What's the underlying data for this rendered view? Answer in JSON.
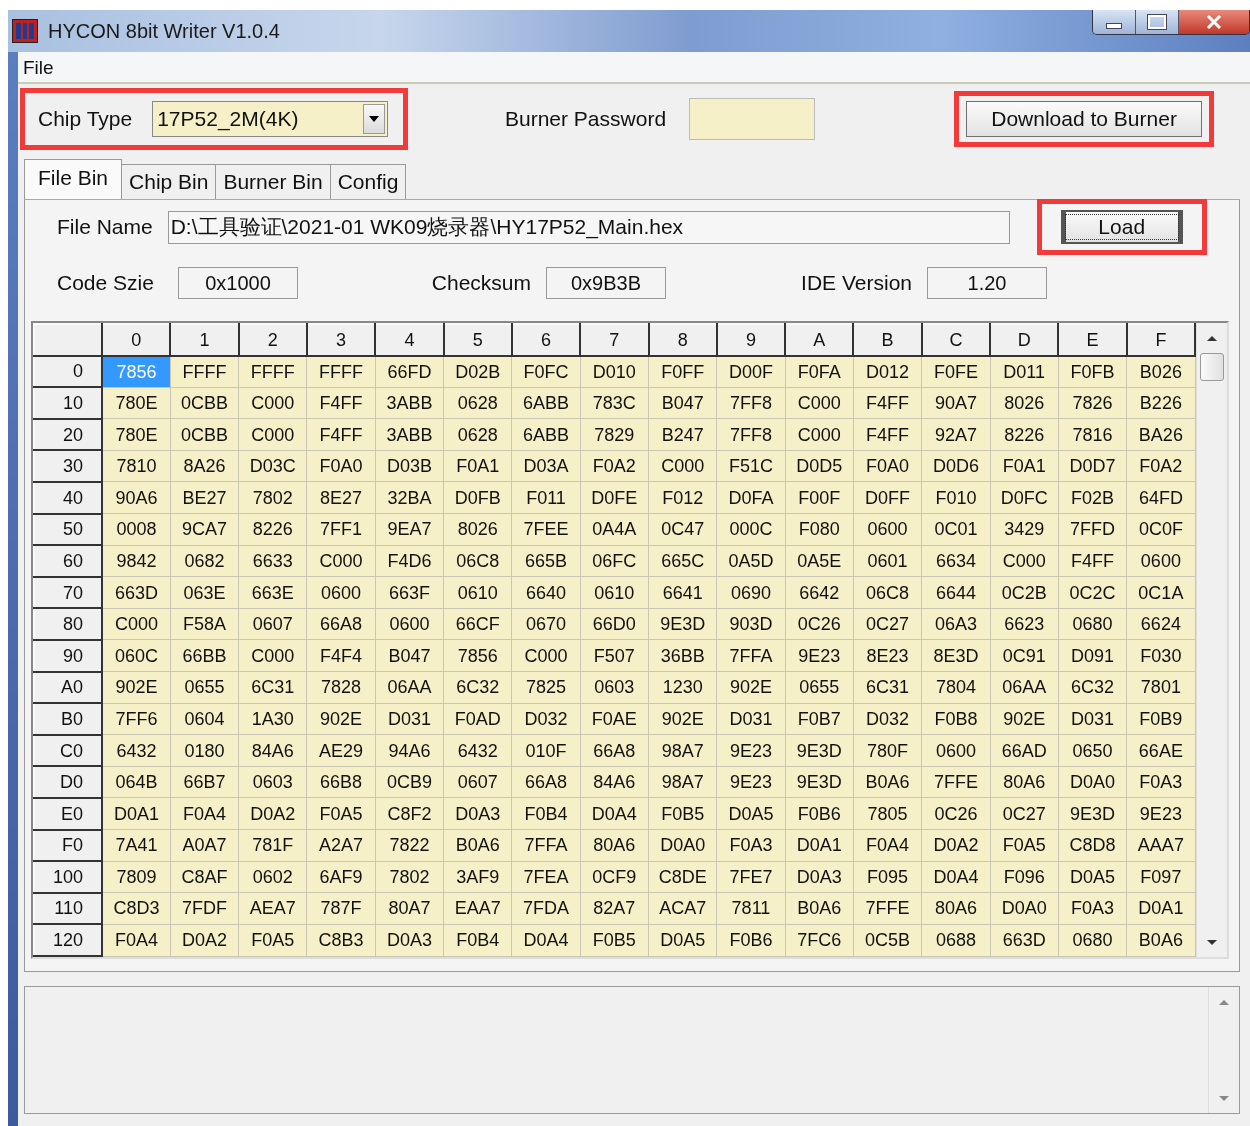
{
  "window": {
    "title": "HYCON 8bit Writer V1.0.4"
  },
  "menu": [
    {
      "label": "File"
    }
  ],
  "chip_type": {
    "label": "Chip Type",
    "value": "17P52_2M(4K)",
    "highlighted": true
  },
  "burner_password": {
    "label": "Burner Password"
  },
  "download_button": {
    "label": "Download to Burner",
    "highlighted": true
  },
  "tabs": [
    {
      "label": "File Bin",
      "selected": true
    },
    {
      "label": "Chip Bin",
      "selected": false
    },
    {
      "label": "Burner Bin",
      "selected": false
    },
    {
      "label": "Config",
      "selected": false
    }
  ],
  "file_name": {
    "label": "File Name",
    "value": "D:\\工具验证\\2021-01 WK09烧录器\\HY17P52_Main.hex"
  },
  "load_button": {
    "label": "Load",
    "highlighted": true
  },
  "info": [
    {
      "label": "Code Szie",
      "value": "0x1000"
    },
    {
      "label": "Checksum",
      "value": "0x9B3B"
    },
    {
      "label": "IDE Version",
      "value": "1.20"
    }
  ],
  "table": {
    "columns": [
      "0",
      "1",
      "2",
      "3",
      "4",
      "5",
      "6",
      "7",
      "8",
      "9",
      "A",
      "B",
      "C",
      "D",
      "E",
      "F"
    ],
    "rows": [
      {
        "address": "0",
        "cells": [
          {
            "text": "7856",
            "selected": true
          },
          {
            "text": "FFFF",
            "selected": false
          },
          {
            "text": "FFFF",
            "selected": false
          },
          {
            "text": "FFFF",
            "selected": false
          },
          {
            "text": "66FD",
            "selected": false
          },
          {
            "text": "D02B",
            "selected": false
          },
          {
            "text": "F0FC",
            "selected": false
          },
          {
            "text": "D010",
            "selected": false
          },
          {
            "text": "F0FF",
            "selected": false
          },
          {
            "text": "D00F",
            "selected": false
          },
          {
            "text": "F0FA",
            "selected": false
          },
          {
            "text": "D012",
            "selected": false
          },
          {
            "text": "F0FE",
            "selected": false
          },
          {
            "text": "D011",
            "selected": false
          },
          {
            "text": "F0FB",
            "selected": false
          },
          {
            "text": "B026",
            "selected": false
          }
        ]
      },
      {
        "address": "10",
        "cells": [
          {
            "text": "780E",
            "selected": false
          },
          {
            "text": "0CBB",
            "selected": false
          },
          {
            "text": "C000",
            "selected": false
          },
          {
            "text": "F4FF",
            "selected": false
          },
          {
            "text": "3ABB",
            "selected": false
          },
          {
            "text": "0628",
            "selected": false
          },
          {
            "text": "6ABB",
            "selected": false
          },
          {
            "text": "783C",
            "selected": false
          },
          {
            "text": "B047",
            "selected": false
          },
          {
            "text": "7FF8",
            "selected": false
          },
          {
            "text": "C000",
            "selected": false
          },
          {
            "text": "F4FF",
            "selected": false
          },
          {
            "text": "90A7",
            "selected": false
          },
          {
            "text": "8026",
            "selected": false
          },
          {
            "text": "7826",
            "selected": false
          },
          {
            "text": "B226",
            "selected": false
          }
        ]
      },
      {
        "address": "20",
        "cells": [
          {
            "text": "780E",
            "selected": false
          },
          {
            "text": "0CBB",
            "selected": false
          },
          {
            "text": "C000",
            "selected": false
          },
          {
            "text": "F4FF",
            "selected": false
          },
          {
            "text": "3ABB",
            "selected": false
          },
          {
            "text": "0628",
            "selected": false
          },
          {
            "text": "6ABB",
            "selected": false
          },
          {
            "text": "7829",
            "selected": false
          },
          {
            "text": "B247",
            "selected": false
          },
          {
            "text": "7FF8",
            "selected": false
          },
          {
            "text": "C000",
            "selected": false
          },
          {
            "text": "F4FF",
            "selected": false
          },
          {
            "text": "92A7",
            "selected": false
          },
          {
            "text": "8226",
            "selected": false
          },
          {
            "text": "7816",
            "selected": false
          },
          {
            "text": "BA26",
            "selected": false
          }
        ]
      },
      {
        "address": "30",
        "cells": [
          {
            "text": "7810",
            "selected": false
          },
          {
            "text": "8A26",
            "selected": false
          },
          {
            "text": "D03C",
            "selected": false
          },
          {
            "text": "F0A0",
            "selected": false
          },
          {
            "text": "D03B",
            "selected": false
          },
          {
            "text": "F0A1",
            "selected": false
          },
          {
            "text": "D03A",
            "selected": false
          },
          {
            "text": "F0A2",
            "selected": false
          },
          {
            "text": "C000",
            "selected": false
          },
          {
            "text": "F51C",
            "selected": false
          },
          {
            "text": "D0D5",
            "selected": false
          },
          {
            "text": "F0A0",
            "selected": false
          },
          {
            "text": "D0D6",
            "selected": false
          },
          {
            "text": "F0A1",
            "selected": false
          },
          {
            "text": "D0D7",
            "selected": false
          },
          {
            "text": "F0A2",
            "selected": false
          }
        ]
      },
      {
        "address": "40",
        "cells": [
          {
            "text": "90A6",
            "selected": false
          },
          {
            "text": "BE27",
            "selected": false
          },
          {
            "text": "7802",
            "selected": false
          },
          {
            "text": "8E27",
            "selected": false
          },
          {
            "text": "32BA",
            "selected": false
          },
          {
            "text": "D0FB",
            "selected": false
          },
          {
            "text": "F011",
            "selected": false
          },
          {
            "text": "D0FE",
            "selected": false
          },
          {
            "text": "F012",
            "selected": false
          },
          {
            "text": "D0FA",
            "selected": false
          },
          {
            "text": "F00F",
            "selected": false
          },
          {
            "text": "D0FF",
            "selected": false
          },
          {
            "text": "F010",
            "selected": false
          },
          {
            "text": "D0FC",
            "selected": false
          },
          {
            "text": "F02B",
            "selected": false
          },
          {
            "text": "64FD",
            "selected": false
          }
        ]
      },
      {
        "address": "50",
        "cells": [
          {
            "text": "0008",
            "selected": false
          },
          {
            "text": "9CA7",
            "selected": false
          },
          {
            "text": "8226",
            "selected": false
          },
          {
            "text": "7FF1",
            "selected": false
          },
          {
            "text": "9EA7",
            "selected": false
          },
          {
            "text": "8026",
            "selected": false
          },
          {
            "text": "7FEE",
            "selected": false
          },
          {
            "text": "0A4A",
            "selected": false
          },
          {
            "text": "0C47",
            "selected": false
          },
          {
            "text": "000C",
            "selected": false
          },
          {
            "text": "F080",
            "selected": false
          },
          {
            "text": "0600",
            "selected": false
          },
          {
            "text": "0C01",
            "selected": false
          },
          {
            "text": "3429",
            "selected": false
          },
          {
            "text": "7FFD",
            "selected": false
          },
          {
            "text": "0C0F",
            "selected": false
          }
        ]
      },
      {
        "address": "60",
        "cells": [
          {
            "text": "9842",
            "selected": false
          },
          {
            "text": "0682",
            "selected": false
          },
          {
            "text": "6633",
            "selected": false
          },
          {
            "text": "C000",
            "selected": false
          },
          {
            "text": "F4D6",
            "selected": false
          },
          {
            "text": "06C8",
            "selected": false
          },
          {
            "text": "665B",
            "selected": false
          },
          {
            "text": "06FC",
            "selected": false
          },
          {
            "text": "665C",
            "selected": false
          },
          {
            "text": "0A5D",
            "selected": false
          },
          {
            "text": "0A5E",
            "selected": false
          },
          {
            "text": "0601",
            "selected": false
          },
          {
            "text": "6634",
            "selected": false
          },
          {
            "text": "C000",
            "selected": false
          },
          {
            "text": "F4FF",
            "selected": false
          },
          {
            "text": "0600",
            "selected": false
          }
        ]
      },
      {
        "address": "70",
        "cells": [
          {
            "text": "663D",
            "selected": false
          },
          {
            "text": "063E",
            "selected": false
          },
          {
            "text": "663E",
            "selected": false
          },
          {
            "text": "0600",
            "selected": false
          },
          {
            "text": "663F",
            "selected": false
          },
          {
            "text": "0610",
            "selected": false
          },
          {
            "text": "6640",
            "selected": false
          },
          {
            "text": "0610",
            "selected": false
          },
          {
            "text": "6641",
            "selected": false
          },
          {
            "text": "0690",
            "selected": false
          },
          {
            "text": "6642",
            "selected": false
          },
          {
            "text": "06C8",
            "selected": false
          },
          {
            "text": "6644",
            "selected": false
          },
          {
            "text": "0C2B",
            "selected": false
          },
          {
            "text": "0C2C",
            "selected": false
          },
          {
            "text": "0C1A",
            "selected": false
          }
        ]
      },
      {
        "address": "80",
        "cells": [
          {
            "text": "C000",
            "selected": false
          },
          {
            "text": "F58A",
            "selected": false
          },
          {
            "text": "0607",
            "selected": false
          },
          {
            "text": "66A8",
            "selected": false
          },
          {
            "text": "0600",
            "selected": false
          },
          {
            "text": "66CF",
            "selected": false
          },
          {
            "text": "0670",
            "selected": false
          },
          {
            "text": "66D0",
            "selected": false
          },
          {
            "text": "9E3D",
            "selected": false
          },
          {
            "text": "903D",
            "selected": false
          },
          {
            "text": "0C26",
            "selected": false
          },
          {
            "text": "0C27",
            "selected": false
          },
          {
            "text": "06A3",
            "selected": false
          },
          {
            "text": "6623",
            "selected": false
          },
          {
            "text": "0680",
            "selected": false
          },
          {
            "text": "6624",
            "selected": false
          }
        ]
      },
      {
        "address": "90",
        "cells": [
          {
            "text": "060C",
            "selected": false
          },
          {
            "text": "66BB",
            "selected": false
          },
          {
            "text": "C000",
            "selected": false
          },
          {
            "text": "F4F4",
            "selected": false
          },
          {
            "text": "B047",
            "selected": false
          },
          {
            "text": "7856",
            "selected": false
          },
          {
            "text": "C000",
            "selected": false
          },
          {
            "text": "F507",
            "selected": false
          },
          {
            "text": "36BB",
            "selected": false
          },
          {
            "text": "7FFA",
            "selected": false
          },
          {
            "text": "9E23",
            "selected": false
          },
          {
            "text": "8E23",
            "selected": false
          },
          {
            "text": "8E3D",
            "selected": false
          },
          {
            "text": "0C91",
            "selected": false
          },
          {
            "text": "D091",
            "selected": false
          },
          {
            "text": "F030",
            "selected": false
          }
        ]
      },
      {
        "address": "A0",
        "cells": [
          {
            "text": "902E",
            "selected": false
          },
          {
            "text": "0655",
            "selected": false
          },
          {
            "text": "6C31",
            "selected": false
          },
          {
            "text": "7828",
            "selected": false
          },
          {
            "text": "06AA",
            "selected": false
          },
          {
            "text": "6C32",
            "selected": false
          },
          {
            "text": "7825",
            "selected": false
          },
          {
            "text": "0603",
            "selected": false
          },
          {
            "text": "1230",
            "selected": false
          },
          {
            "text": "902E",
            "selected": false
          },
          {
            "text": "0655",
            "selected": false
          },
          {
            "text": "6C31",
            "selected": false
          },
          {
            "text": "7804",
            "selected": false
          },
          {
            "text": "06AA",
            "selected": false
          },
          {
            "text": "6C32",
            "selected": false
          },
          {
            "text": "7801",
            "selected": false
          }
        ]
      },
      {
        "address": "B0",
        "cells": [
          {
            "text": "7FF6",
            "selected": false
          },
          {
            "text": "0604",
            "selected": false
          },
          {
            "text": "1A30",
            "selected": false
          },
          {
            "text": "902E",
            "selected": false
          },
          {
            "text": "D031",
            "selected": false
          },
          {
            "text": "F0AD",
            "selected": false
          },
          {
            "text": "D032",
            "selected": false
          },
          {
            "text": "F0AE",
            "selected": false
          },
          {
            "text": "902E",
            "selected": false
          },
          {
            "text": "D031",
            "selected": false
          },
          {
            "text": "F0B7",
            "selected": false
          },
          {
            "text": "D032",
            "selected": false
          },
          {
            "text": "F0B8",
            "selected": false
          },
          {
            "text": "902E",
            "selected": false
          },
          {
            "text": "D031",
            "selected": false
          },
          {
            "text": "F0B9",
            "selected": false
          }
        ]
      },
      {
        "address": "C0",
        "cells": [
          {
            "text": "6432",
            "selected": false
          },
          {
            "text": "0180",
            "selected": false
          },
          {
            "text": "84A6",
            "selected": false
          },
          {
            "text": "AE29",
            "selected": false
          },
          {
            "text": "94A6",
            "selected": false
          },
          {
            "text": "6432",
            "selected": false
          },
          {
            "text": "010F",
            "selected": false
          },
          {
            "text": "66A8",
            "selected": false
          },
          {
            "text": "98A7",
            "selected": false
          },
          {
            "text": "9E23",
            "selected": false
          },
          {
            "text": "9E3D",
            "selected": false
          },
          {
            "text": "780F",
            "selected": false
          },
          {
            "text": "0600",
            "selected": false
          },
          {
            "text": "66AD",
            "selected": false
          },
          {
            "text": "0650",
            "selected": false
          },
          {
            "text": "66AE",
            "selected": false
          }
        ]
      },
      {
        "address": "D0",
        "cells": [
          {
            "text": "064B",
            "selected": false
          },
          {
            "text": "66B7",
            "selected": false
          },
          {
            "text": "0603",
            "selected": false
          },
          {
            "text": "66B8",
            "selected": false
          },
          {
            "text": "0CB9",
            "selected": false
          },
          {
            "text": "0607",
            "selected": false
          },
          {
            "text": "66A8",
            "selected": false
          },
          {
            "text": "84A6",
            "selected": false
          },
          {
            "text": "98A7",
            "selected": false
          },
          {
            "text": "9E23",
            "selected": false
          },
          {
            "text": "9E3D",
            "selected": false
          },
          {
            "text": "B0A6",
            "selected": false
          },
          {
            "text": "7FFE",
            "selected": false
          },
          {
            "text": "80A6",
            "selected": false
          },
          {
            "text": "D0A0",
            "selected": false
          },
          {
            "text": "F0A3",
            "selected": false
          }
        ]
      },
      {
        "address": "E0",
        "cells": [
          {
            "text": "D0A1",
            "selected": false
          },
          {
            "text": "F0A4",
            "selected": false
          },
          {
            "text": "D0A2",
            "selected": false
          },
          {
            "text": "F0A5",
            "selected": false
          },
          {
            "text": "C8F2",
            "selected": false
          },
          {
            "text": "D0A3",
            "selected": false
          },
          {
            "text": "F0B4",
            "selected": false
          },
          {
            "text": "D0A4",
            "selected": false
          },
          {
            "text": "F0B5",
            "selected": false
          },
          {
            "text": "D0A5",
            "selected": false
          },
          {
            "text": "F0B6",
            "selected": false
          },
          {
            "text": "7805",
            "selected": false
          },
          {
            "text": "0C26",
            "selected": false
          },
          {
            "text": "0C27",
            "selected": false
          },
          {
            "text": "9E3D",
            "selected": false
          },
          {
            "text": "9E23",
            "selected": false
          }
        ]
      },
      {
        "address": "F0",
        "cells": [
          {
            "text": "7A41",
            "selected": false
          },
          {
            "text": "A0A7",
            "selected": false
          },
          {
            "text": "781F",
            "selected": false
          },
          {
            "text": "A2A7",
            "selected": false
          },
          {
            "text": "7822",
            "selected": false
          },
          {
            "text": "B0A6",
            "selected": false
          },
          {
            "text": "7FFA",
            "selected": false
          },
          {
            "text": "80A6",
            "selected": false
          },
          {
            "text": "D0A0",
            "selected": false
          },
          {
            "text": "F0A3",
            "selected": false
          },
          {
            "text": "D0A1",
            "selected": false
          },
          {
            "text": "F0A4",
            "selected": false
          },
          {
            "text": "D0A2",
            "selected": false
          },
          {
            "text": "F0A5",
            "selected": false
          },
          {
            "text": "C8D8",
            "selected": false
          },
          {
            "text": "AAA7",
            "selected": false
          }
        ]
      },
      {
        "address": "100",
        "cells": [
          {
            "text": "7809",
            "selected": false
          },
          {
            "text": "C8AF",
            "selected": false
          },
          {
            "text": "0602",
            "selected": false
          },
          {
            "text": "6AF9",
            "selected": false
          },
          {
            "text": "7802",
            "selected": false
          },
          {
            "text": "3AF9",
            "selected": false
          },
          {
            "text": "7FEA",
            "selected": false
          },
          {
            "text": "0CF9",
            "selected": false
          },
          {
            "text": "C8DE",
            "selected": false
          },
          {
            "text": "7FE7",
            "selected": false
          },
          {
            "text": "D0A3",
            "selected": false
          },
          {
            "text": "F095",
            "selected": false
          },
          {
            "text": "D0A4",
            "selected": false
          },
          {
            "text": "F096",
            "selected": false
          },
          {
            "text": "D0A5",
            "selected": false
          },
          {
            "text": "F097",
            "selected": false
          }
        ]
      },
      {
        "address": "110",
        "cells": [
          {
            "text": "C8D3",
            "selected": false
          },
          {
            "text": "7FDF",
            "selected": false
          },
          {
            "text": "AEA7",
            "selected": false
          },
          {
            "text": "787F",
            "selected": false
          },
          {
            "text": "80A7",
            "selected": false
          },
          {
            "text": "EAA7",
            "selected": false
          },
          {
            "text": "7FDA",
            "selected": false
          },
          {
            "text": "82A7",
            "selected": false
          },
          {
            "text": "ACA7",
            "selected": false
          },
          {
            "text": "7811",
            "selected": false
          },
          {
            "text": "B0A6",
            "selected": false
          },
          {
            "text": "7FFE",
            "selected": false
          },
          {
            "text": "80A6",
            "selected": false
          },
          {
            "text": "D0A0",
            "selected": false
          },
          {
            "text": "F0A3",
            "selected": false
          },
          {
            "text": "D0A1",
            "selected": false
          }
        ]
      },
      {
        "address": "120",
        "cells": [
          {
            "text": "F0A4",
            "selected": false
          },
          {
            "text": "D0A2",
            "selected": false
          },
          {
            "text": "F0A5",
            "selected": false
          },
          {
            "text": "C8B3",
            "selected": false
          },
          {
            "text": "D0A3",
            "selected": false
          },
          {
            "text": "F0B4",
            "selected": false
          },
          {
            "text": "D0A4",
            "selected": false
          },
          {
            "text": "F0B5",
            "selected": false
          },
          {
            "text": "D0A5",
            "selected": false
          },
          {
            "text": "F0B6",
            "selected": false
          },
          {
            "text": "7FC6",
            "selected": false
          },
          {
            "text": "0C5B",
            "selected": false
          },
          {
            "text": "0688",
            "selected": false
          },
          {
            "text": "663D",
            "selected": false
          },
          {
            "text": "0680",
            "selected": false
          },
          {
            "text": "B0A6",
            "selected": false
          }
        ]
      }
    ]
  }
}
